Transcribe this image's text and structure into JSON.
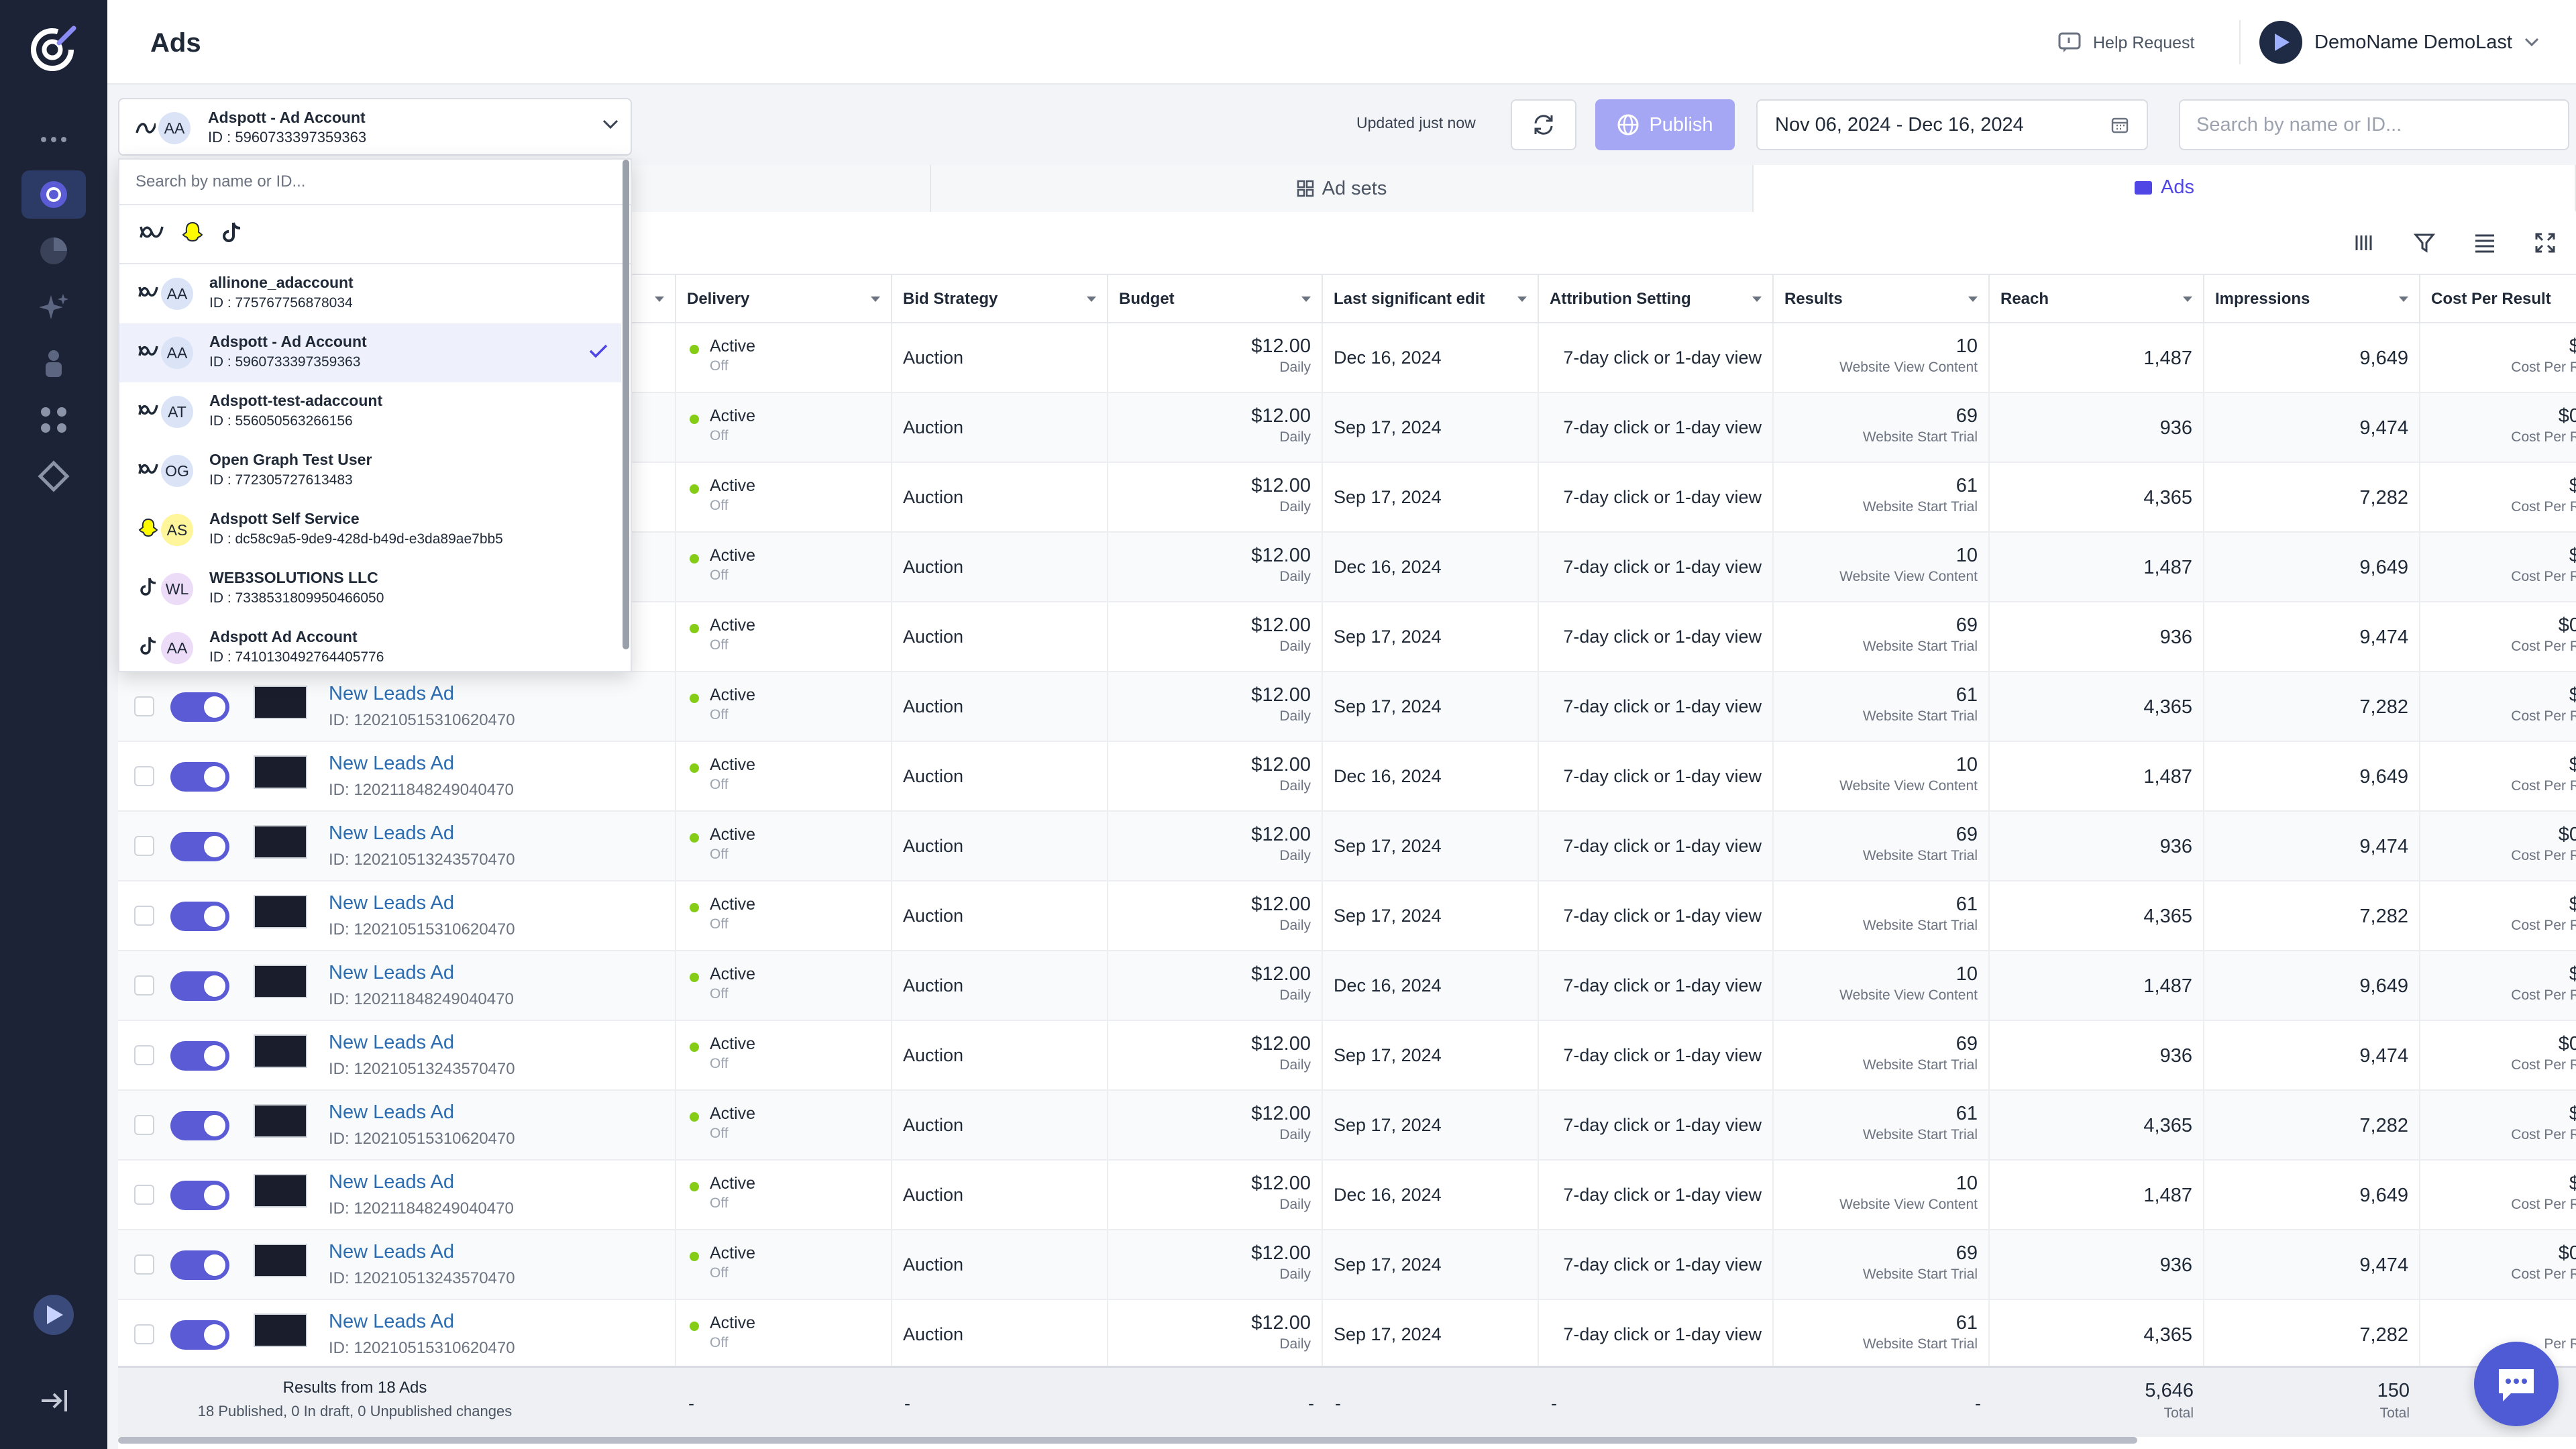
{
  "app": {
    "page_title": "Ads"
  },
  "header": {
    "help_label": "Help Request",
    "user_name": "DemoName DemoLast"
  },
  "toolbar": {
    "account_name": "Adspott - Ad Account",
    "account_id": "ID : 5960733397359363",
    "account_initials": "AA",
    "updated_text": "Updated just now",
    "publish_label": "Publish",
    "date_range": "Nov 06, 2024 - Dec 16, 2024",
    "search_placeholder": "Search by name or ID..."
  },
  "tabs": [
    {
      "label": "Ad sets"
    },
    {
      "label": "Ads",
      "active": true
    }
  ],
  "columns": [
    "Delivery",
    "Bid Strategy",
    "Budget",
    "Last significant edit",
    "Attribution Setting",
    "Results",
    "Reach",
    "Impressions",
    "Cost Per Result"
  ],
  "rows": [
    {
      "name": "",
      "id": "",
      "delivery": "Active",
      "delivery_sub": "Off",
      "bid": "Auction",
      "budget": "$12.00",
      "budget_sub": "Daily",
      "edit": "Dec 16, 2024",
      "attr": "7-day click or 1-day view",
      "results": "10",
      "results_sub": "Website View Content",
      "reach": "1,487",
      "impressions": "9,649",
      "cpr": "$",
      "cpr_sub": "Cost Per R"
    },
    {
      "name": "",
      "id": "",
      "delivery": "Active",
      "delivery_sub": "Off",
      "bid": "Auction",
      "budget": "$12.00",
      "budget_sub": "Daily",
      "edit": "Sep 17, 2024",
      "attr": "7-day click or 1-day view",
      "results": "69",
      "results_sub": "Website Start Trial",
      "reach": "936",
      "impressions": "9,474",
      "cpr": "$0",
      "cpr_sub": "Cost Per R"
    },
    {
      "name": "",
      "id": "",
      "delivery": "Active",
      "delivery_sub": "Off",
      "bid": "Auction",
      "budget": "$12.00",
      "budget_sub": "Daily",
      "edit": "Sep 17, 2024",
      "attr": "7-day click or 1-day view",
      "results": "61",
      "results_sub": "Website Start Trial",
      "reach": "4,365",
      "impressions": "7,282",
      "cpr": "$",
      "cpr_sub": "Cost Per R"
    },
    {
      "name": "",
      "id": "",
      "delivery": "Active",
      "delivery_sub": "Off",
      "bid": "Auction",
      "budget": "$12.00",
      "budget_sub": "Daily",
      "edit": "Dec 16, 2024",
      "attr": "7-day click or 1-day view",
      "results": "10",
      "results_sub": "Website View Content",
      "reach": "1,487",
      "impressions": "9,649",
      "cpr": "$",
      "cpr_sub": "Cost Per R"
    },
    {
      "name": "",
      "id": "",
      "delivery": "Active",
      "delivery_sub": "Off",
      "bid": "Auction",
      "budget": "$12.00",
      "budget_sub": "Daily",
      "edit": "Sep 17, 2024",
      "attr": "7-day click or 1-day view",
      "results": "69",
      "results_sub": "Website Start Trial",
      "reach": "936",
      "impressions": "9,474",
      "cpr": "$0",
      "cpr_sub": "Cost Per R"
    },
    {
      "name": "New Leads Ad",
      "id": "ID: 120210515310620470",
      "delivery": "Active",
      "delivery_sub": "Off",
      "bid": "Auction",
      "budget": "$12.00",
      "budget_sub": "Daily",
      "edit": "Sep 17, 2024",
      "attr": "7-day click or 1-day view",
      "results": "61",
      "results_sub": "Website Start Trial",
      "reach": "4,365",
      "impressions": "7,282",
      "cpr": "$",
      "cpr_sub": "Cost Per R"
    },
    {
      "name": "New Leads Ad",
      "id": "ID: 120211848249040470",
      "delivery": "Active",
      "delivery_sub": "Off",
      "bid": "Auction",
      "budget": "$12.00",
      "budget_sub": "Daily",
      "edit": "Dec 16, 2024",
      "attr": "7-day click or 1-day view",
      "results": "10",
      "results_sub": "Website View Content",
      "reach": "1,487",
      "impressions": "9,649",
      "cpr": "$",
      "cpr_sub": "Cost Per R"
    },
    {
      "name": "New Leads Ad",
      "id": "ID: 120210513243570470",
      "delivery": "Active",
      "delivery_sub": "Off",
      "bid": "Auction",
      "budget": "$12.00",
      "budget_sub": "Daily",
      "edit": "Sep 17, 2024",
      "attr": "7-day click or 1-day view",
      "results": "69",
      "results_sub": "Website Start Trial",
      "reach": "936",
      "impressions": "9,474",
      "cpr": "$0",
      "cpr_sub": "Cost Per R"
    },
    {
      "name": "New Leads Ad",
      "id": "ID: 120210515310620470",
      "delivery": "Active",
      "delivery_sub": "Off",
      "bid": "Auction",
      "budget": "$12.00",
      "budget_sub": "Daily",
      "edit": "Sep 17, 2024",
      "attr": "7-day click or 1-day view",
      "results": "61",
      "results_sub": "Website Start Trial",
      "reach": "4,365",
      "impressions": "7,282",
      "cpr": "$",
      "cpr_sub": "Cost Per R"
    },
    {
      "name": "New Leads Ad",
      "id": "ID: 120211848249040470",
      "delivery": "Active",
      "delivery_sub": "Off",
      "bid": "Auction",
      "budget": "$12.00",
      "budget_sub": "Daily",
      "edit": "Dec 16, 2024",
      "attr": "7-day click or 1-day view",
      "results": "10",
      "results_sub": "Website View Content",
      "reach": "1,487",
      "impressions": "9,649",
      "cpr": "$",
      "cpr_sub": "Cost Per R"
    },
    {
      "name": "New Leads Ad",
      "id": "ID: 120210513243570470",
      "delivery": "Active",
      "delivery_sub": "Off",
      "bid": "Auction",
      "budget": "$12.00",
      "budget_sub": "Daily",
      "edit": "Sep 17, 2024",
      "attr": "7-day click or 1-day view",
      "results": "69",
      "results_sub": "Website Start Trial",
      "reach": "936",
      "impressions": "9,474",
      "cpr": "$0",
      "cpr_sub": "Cost Per R"
    },
    {
      "name": "New Leads Ad",
      "id": "ID: 120210515310620470",
      "delivery": "Active",
      "delivery_sub": "Off",
      "bid": "Auction",
      "budget": "$12.00",
      "budget_sub": "Daily",
      "edit": "Sep 17, 2024",
      "attr": "7-day click or 1-day view",
      "results": "61",
      "results_sub": "Website Start Trial",
      "reach": "4,365",
      "impressions": "7,282",
      "cpr": "$",
      "cpr_sub": "Cost Per R"
    },
    {
      "name": "New Leads Ad",
      "id": "ID: 120211848249040470",
      "delivery": "Active",
      "delivery_sub": "Off",
      "bid": "Auction",
      "budget": "$12.00",
      "budget_sub": "Daily",
      "edit": "Dec 16, 2024",
      "attr": "7-day click or 1-day view",
      "results": "10",
      "results_sub": "Website View Content",
      "reach": "1,487",
      "impressions": "9,649",
      "cpr": "$",
      "cpr_sub": "Cost Per R"
    },
    {
      "name": "New Leads Ad",
      "id": "ID: 120210513243570470",
      "delivery": "Active",
      "delivery_sub": "Off",
      "bid": "Auction",
      "budget": "$12.00",
      "budget_sub": "Daily",
      "edit": "Sep 17, 2024",
      "attr": "7-day click or 1-day view",
      "results": "69",
      "results_sub": "Website Start Trial",
      "reach": "936",
      "impressions": "9,474",
      "cpr": "$0",
      "cpr_sub": "Cost Per R"
    },
    {
      "name": "New Leads Ad",
      "id": "ID: 120210515310620470",
      "delivery": "Active",
      "delivery_sub": "Off",
      "bid": "Auction",
      "budget": "$12.00",
      "budget_sub": "Daily",
      "edit": "Sep 17, 2024",
      "attr": "7-day click or 1-day view",
      "results": "61",
      "results_sub": "Website Start Trial",
      "reach": "4,365",
      "impressions": "7,282",
      "cpr": "",
      "cpr_sub": "Per R"
    }
  ],
  "footer": {
    "results_title": "Results from 18 Ads",
    "results_sub": "18 Published, 0 In draft, 0 Unpublished changes",
    "dash": "-",
    "reach_total": "5,646",
    "impressions_total": "150",
    "total_label": "Total"
  },
  "dropdown": {
    "search_placeholder": "Search by name or ID...",
    "filters": [
      "meta-icon",
      "snapchat-icon",
      "tiktok-icon"
    ],
    "items": [
      {
        "name": "allinone_adaccount",
        "id": "ID : 775767756878034",
        "initials": "AA",
        "platform": "meta",
        "selected": false
      },
      {
        "name": "Adspott - Ad Account",
        "id": "ID : 5960733397359363",
        "initials": "AA",
        "platform": "meta",
        "selected": true
      },
      {
        "name": "Adspott-test-adaccount",
        "id": "ID : 556050563266156",
        "initials": "AT",
        "platform": "meta",
        "selected": false
      },
      {
        "name": "Open Graph Test User",
        "id": "ID : 772305727613483",
        "initials": "OG",
        "platform": "meta",
        "selected": false
      },
      {
        "name": "Adspott Self Service",
        "id": "ID : dc58c9a5-9de9-428d-b49d-e3da89ae7bb5",
        "initials": "AS",
        "platform": "snapchat",
        "selected": false
      },
      {
        "name": "WEB3SOLUTIONS LLC",
        "id": "ID : 7338531809950466050",
        "initials": "WL",
        "platform": "tiktok",
        "selected": false
      },
      {
        "name": "Adspott Ad Account",
        "id": "ID : 7410130492764405776",
        "initials": "AA",
        "platform": "tiktok",
        "selected": false
      }
    ]
  },
  "colors": {
    "accent": "#4f46e5",
    "sidebar": "#1c2336",
    "link": "#2b6cb0",
    "active_dot": "#84cc16",
    "toggle": "#5b5bd6"
  }
}
